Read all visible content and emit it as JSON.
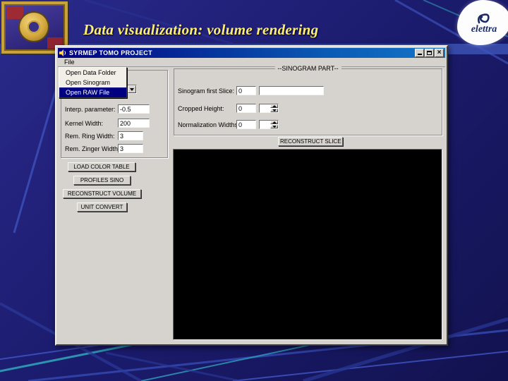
{
  "slide": {
    "title": "Data visualization: volume rendering",
    "logos": {
      "right_text": "elettra"
    }
  },
  "window": {
    "title": "SYRMEP TOMO PROJECT",
    "controls": {
      "close_glyph": "×"
    },
    "menu_bar": {
      "file": "File"
    },
    "file_menu": {
      "items": [
        {
          "label": "Open Data Folder",
          "highlighted": false
        },
        {
          "label": "Open Sinogram",
          "highlighted": false
        },
        {
          "label": "Open RAW File",
          "highlighted": true
        }
      ]
    },
    "left_panel": {
      "combo_value": "",
      "fields": [
        {
          "label": "Interp. parameter:",
          "value": "-0.5"
        },
        {
          "label": "Kernel Width:",
          "value": "200"
        },
        {
          "label": "Rem. Ring Width:",
          "value": "3"
        },
        {
          "label": "Rem. Zinger Width:",
          "value": "3"
        }
      ],
      "buttons": [
        "LOAD COLOR TABLE",
        "PROFILES SINO",
        "RECONSTRUCT VOLUME",
        "UNIT CONVERT"
      ]
    },
    "sinogram_panel": {
      "title": "--SINOGRAM PART--",
      "fields": [
        {
          "label": "Sinogram first Slice:",
          "value": "0",
          "extra": ""
        },
        {
          "label": "Cropped Height:",
          "value": "0",
          "spin": ""
        },
        {
          "label": "Normalization Widths:",
          "value": "0",
          "spin": ""
        }
      ],
      "reconstruct_button": "RECONSTRUCT SLICE"
    }
  },
  "colors": {
    "slide_background": "#1c1c70",
    "title_text": "#ffef70",
    "titlebar_start": "#000080",
    "titlebar_end": "#1274c8",
    "menu_highlight": "#000080",
    "window_chrome": "#d6d3ce",
    "display_area": "#000000",
    "decoration_teal": "#2fa0b8",
    "decoration_blue": "#4157c8"
  }
}
